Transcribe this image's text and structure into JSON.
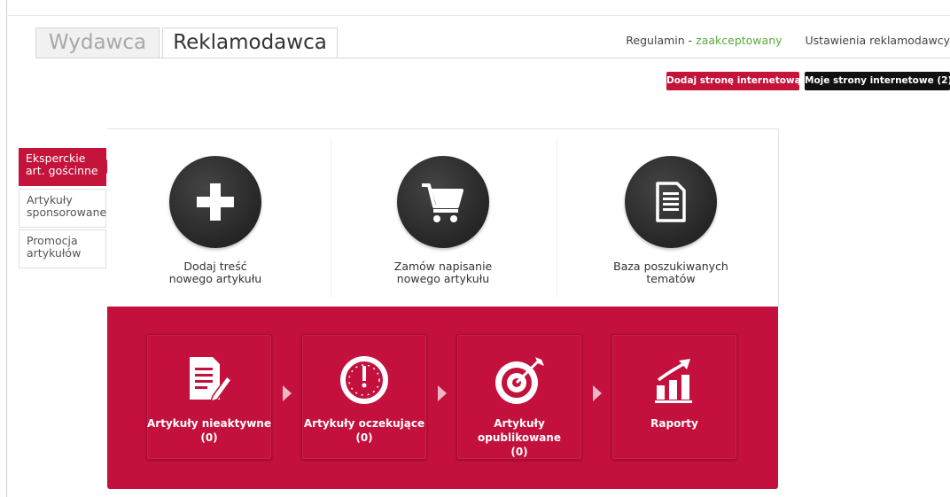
{
  "tabs": [
    {
      "label": "Wydawca",
      "active": false
    },
    {
      "label": "Reklamodawca",
      "active": true
    }
  ],
  "top_links": {
    "terms_label": "Regulamin - ",
    "terms_status": "zaakceptowany",
    "settings": "Ustawienia reklamodawcy"
  },
  "buttons": {
    "add_site": "Dodaj stronę internetową",
    "my_sites": "Moje strony internetowe (2)"
  },
  "sidebar": {
    "items": [
      {
        "label": "Eksperckie\nart. gościnne",
        "active": true
      },
      {
        "label": "Artykuły\nsponsorowane",
        "active": false
      },
      {
        "label": "Promocja\nartykułów",
        "active": false
      }
    ]
  },
  "actions": [
    {
      "icon": "plus-icon",
      "label": "Dodaj treść\nnowego artykułu"
    },
    {
      "icon": "cart-icon",
      "label": "Zamów napisanie\nnowego artykułu"
    },
    {
      "icon": "document-icon",
      "label": "Baza poszukiwanych\ntematów"
    }
  ],
  "cards": [
    {
      "icon": "inactive-articles-icon",
      "label": "Artykuły nieaktywne",
      "count": "(0)"
    },
    {
      "icon": "clock-icon",
      "label": "Artykuły oczekujące",
      "count": "(0)"
    },
    {
      "icon": "target-icon",
      "label": "Artykuły opublikowane",
      "count": "(0)"
    },
    {
      "icon": "chart-icon",
      "label": "Raporty",
      "count": ""
    }
  ],
  "colors": {
    "accent": "#c4103c",
    "status_green": "#5aaa3c",
    "dark_button": "#111111",
    "icon_circle": "#262626"
  }
}
